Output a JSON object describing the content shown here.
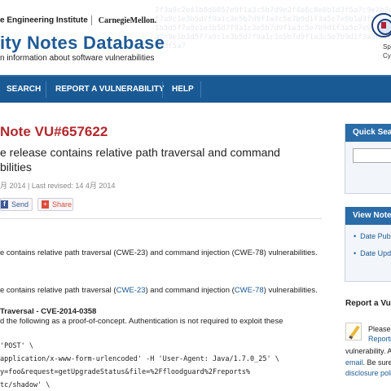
{
  "header": {
    "institute": "e Engineering Institute",
    "university": "CarnegieMellon.",
    "title": "ity Notes Database",
    "subtitle": "n information about software vulnerabilities",
    "dhs_text_1": "Sp",
    "dhs_text_2": "Cyber"
  },
  "nav": {
    "search": "SEARCH",
    "report": "REPORT A VULNERABILITY",
    "help": "HELP"
  },
  "note": {
    "title": "Note VU#657622",
    "summary": "e release contains relative path traversal and command bilities",
    "dates": "月 2014 | Last revised: 14 4月 2014"
  },
  "share": {
    "send_label": "Send",
    "share_label": "Share"
  },
  "body": {
    "overview": "e contains relative path traversal (CWE-23) and command injection (CWE-78) vulnerabilities.",
    "desc_prefix": "e contains relative path traversal (",
    "desc_cwe23": "CWE-23",
    "desc_mid": ") and command injection (",
    "desc_cwe78": "CWE-78",
    "desc_suffix": ") vulnerabilities.",
    "traversal_heading": "Traversal - CVE-2014-0358",
    "traversal_text": "d the following as a proof-of-concept. Authentication is not required to exploit these",
    "code_1": "'POST' \\",
    "code_2": "application/x-www-form-urlencoded' -H 'User-Agent: Java/1.7.0_25' \\",
    "code_3": "y=foo&request=getUpgradeStatus&file=%2Ffloodguard%2Freports%",
    "code_4": "tc/shadow' \\"
  },
  "sidebar": {
    "quick_search": "Quick Search",
    "view_notes": "View Notes",
    "date_published": "Date Publ",
    "date_updated": "Date Upda",
    "report_heading": "Report a Vul",
    "report_please": "Please",
    "report_reporting": "Reporti",
    "report_vuln": "vulnerability. Al",
    "report_email": "email",
    "report_be_sure": ". Be sure t",
    "report_policy": "disclosure polic"
  },
  "hash_text": "7f3a9c2e41b8d6057e9f1a3c5b7d9e2f4a6c8e0b1d3f5a7c9e1b3d5f7a9c1e3b5d7f9a1c3e5b7d9f1a3c5e7b9d1f3a5c7e9b1d3f5a7c9e1b3d5f7a9c1e3b5d7f9a1c3e5b7d9f1a3c5e7b9d1f3a5c7e9b1d3f5a7c9e1b3d5f7a9c1e3b5d7f9a1c3e5b7d9f1a3c5e7b9d1f3a5c7e9b1d3f5a7",
  "colors": {
    "nav_blue": "#1a5a94",
    "title_red": "#b3282d",
    "link_blue": "#1a5a94"
  }
}
